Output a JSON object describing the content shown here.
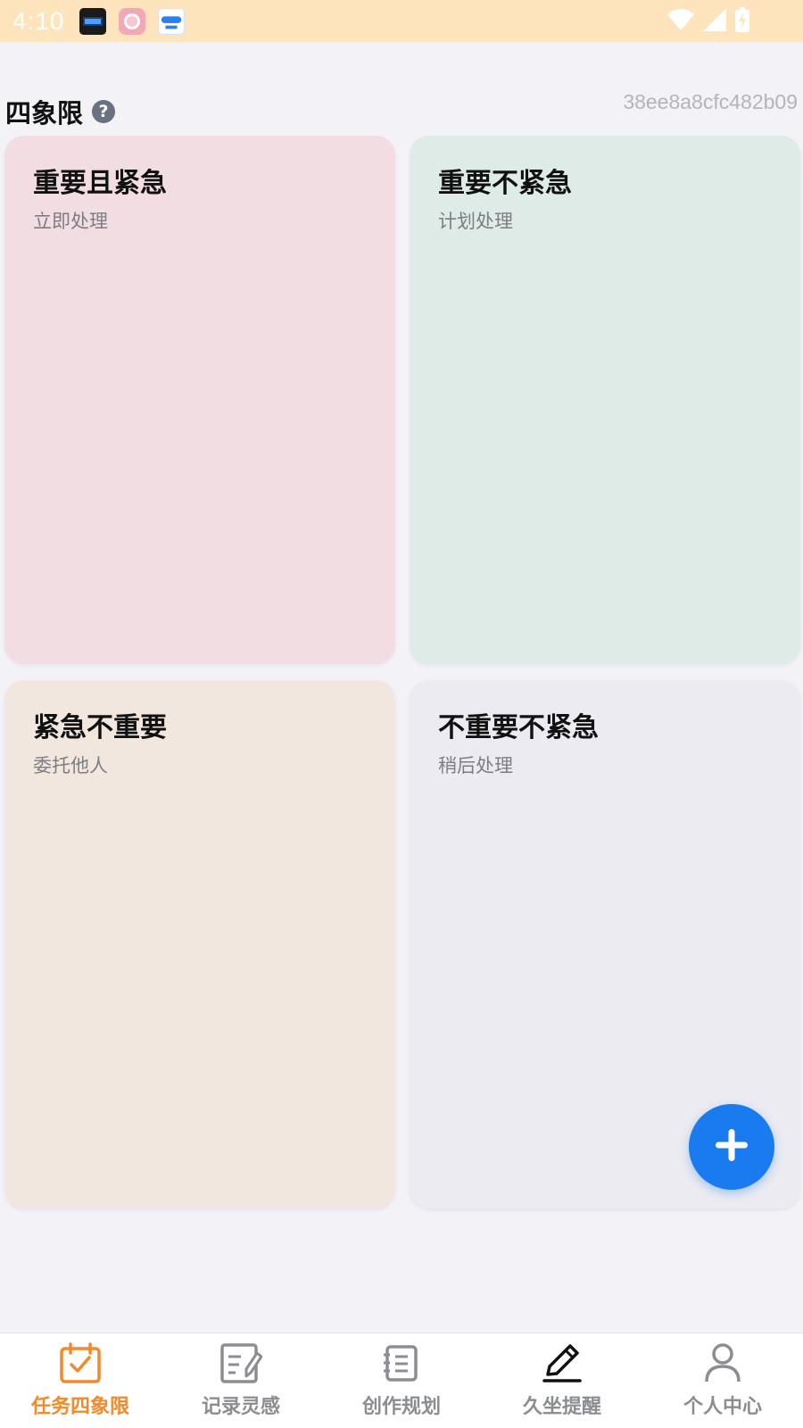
{
  "status_bar": {
    "time": "4:10",
    "bg_color": "#fde4bd",
    "icons": [
      "clock-widget-notification-icon",
      "pink-app-notification-icon",
      "blue-app-notification-icon",
      "wifi-icon",
      "cellular-signal-icon",
      "battery-charging-icon"
    ]
  },
  "header": {
    "title": "四象限",
    "help_icon": "question-circle-icon",
    "device_id": "38ee8a8cfc482b09"
  },
  "quadrants": [
    {
      "title": "重要且紧急",
      "subtitle": "立即处理",
      "color": "#f2dde3"
    },
    {
      "title": "重要不紧急",
      "subtitle": "计划处理",
      "color": "#deebe7"
    },
    {
      "title": "紧急不重要",
      "subtitle": "委托他人",
      "color": "#f2e7de"
    },
    {
      "title": "不重要不紧急",
      "subtitle": "稍后处理",
      "color": "#ebebf1"
    }
  ],
  "fab": {
    "icon": "plus-icon",
    "color": "#1a7bf0"
  },
  "bottom_nav": {
    "active_color": "#f08a2b",
    "inactive_color": "#8b8d92",
    "items": [
      {
        "label": "任务四象限",
        "icon": "calendar-check-icon",
        "active": true
      },
      {
        "label": "记录灵感",
        "icon": "note-edit-icon",
        "active": false
      },
      {
        "label": "创作规划",
        "icon": "notebook-icon",
        "active": false
      },
      {
        "label": "久坐提醒",
        "icon": "pencil-icon",
        "active": false
      },
      {
        "label": "个人中心",
        "icon": "person-icon",
        "active": false
      }
    ]
  }
}
